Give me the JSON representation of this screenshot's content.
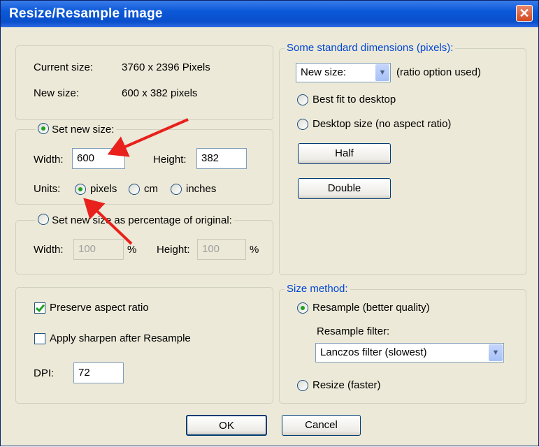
{
  "window": {
    "title": "Resize/Resample image",
    "close_glyph": "✕"
  },
  "info": {
    "current_label": "Current size:",
    "current_value": "3760 x 2396  Pixels",
    "new_label": "New size:",
    "new_value": "600 x 382  pixels"
  },
  "set_new_size": {
    "label": "Set new size:",
    "selected": true,
    "width_label": "Width:",
    "width_value": "600",
    "height_label": "Height:",
    "height_value": "382",
    "units_label": "Units:",
    "units": [
      {
        "label": "pixels",
        "selected": true
      },
      {
        "label": "cm",
        "selected": false
      },
      {
        "label": "inches",
        "selected": false
      }
    ]
  },
  "percentage": {
    "label": "Set new size as percentage of original:",
    "selected": false,
    "width_label": "Width:",
    "width_value": "100",
    "width_unit": "%",
    "height_label": "Height:",
    "height_value": "100",
    "height_unit": "%"
  },
  "standard_dims": {
    "legend": "Some standard dimensions (pixels):",
    "combo_value": "New size:",
    "combo_note": "(ratio option used)",
    "best_fit": "Best fit to desktop",
    "desktop_size": "Desktop size (no aspect ratio)",
    "half_button": "Half",
    "double_button": "Double"
  },
  "options": {
    "preserve_aspect": "Preserve aspect ratio",
    "preserve_checked": true,
    "apply_sharpen": "Apply sharpen after Resample",
    "sharpen_checked": false,
    "dpi_label": "DPI:",
    "dpi_value": "72"
  },
  "size_method": {
    "legend": "Size method:",
    "resample": "Resample (better quality)",
    "resample_selected": true,
    "filter_label": "Resample filter:",
    "filter_value": "Lanczos filter (slowest)",
    "resize": "Resize (faster)",
    "resize_selected": false
  },
  "buttons": {
    "ok": "OK",
    "cancel": "Cancel"
  },
  "annotation_color": "#e8211d"
}
